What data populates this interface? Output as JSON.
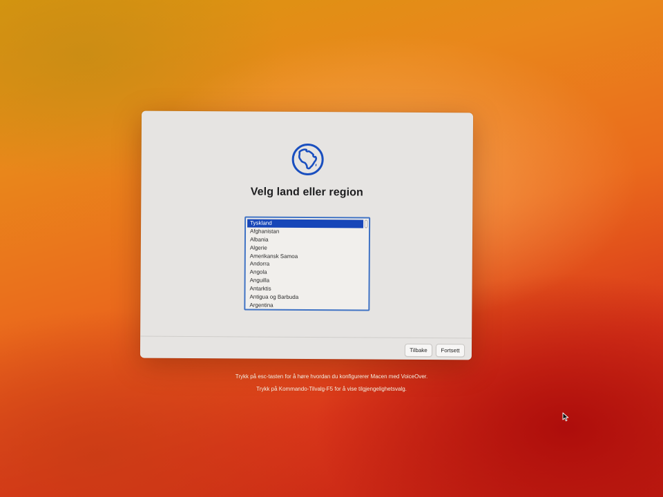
{
  "dialog": {
    "title": "Velg land eller region",
    "icon": "globe-africa-icon",
    "accent": "#1a4fbf",
    "countries": [
      "Tyskland",
      "Afghanistan",
      "Albania",
      "Algerie",
      "Amerikansk Samoa",
      "Andorra",
      "Angola",
      "Anguilla",
      "Antarktis",
      "Antigua og Barbuda",
      "Argentina"
    ],
    "selected": "Tyskland",
    "buttons": {
      "back": "Tilbake",
      "continue": "Fortsett"
    }
  },
  "hints": {
    "voiceover": "Trykk på esc-tasten for å høre hvordan du konfigurerer Macen med VoiceOver.",
    "accessibility": "Trykk på Kommando-Tilvalg-F5 for å vise tilgjengelighetsvalg."
  }
}
